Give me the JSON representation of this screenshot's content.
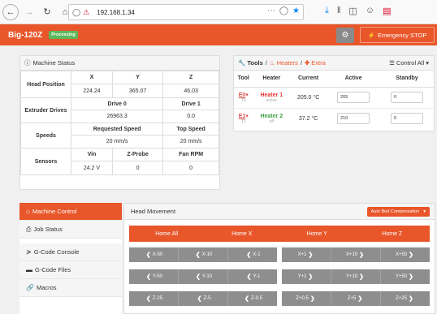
{
  "browser": {
    "url": "192.168.1.34",
    "icons": [
      "back-icon",
      "forward-icon",
      "reload-icon",
      "home-icon",
      "shield-icon",
      "insecure-lock-icon",
      "more-icon",
      "pocket-icon",
      "bookmark-star-icon",
      "download-icon",
      "library-icon",
      "sidebar-icon",
      "account-icon",
      "pocket-save-icon"
    ]
  },
  "topnav": {
    "brand": "Big-120Z",
    "status_badge": "Processing",
    "estop_label": "Emergency STOP",
    "colors": {
      "accent": "#e8562a",
      "badge": "#5cb85c"
    }
  },
  "machine_status": {
    "title": "Machine Status",
    "head_position": {
      "label": "Head Position",
      "axes": [
        "X",
        "Y",
        "Z"
      ],
      "values": [
        "224.24",
        "365.07",
        "46.03"
      ]
    },
    "extruder": {
      "label": "Extruder Drives",
      "headers": [
        "Drive 0",
        "Drive 1"
      ],
      "values": [
        "26963.3",
        "0.0"
      ]
    },
    "speeds": {
      "label": "Speeds",
      "headers": [
        "Requested Speed",
        "Top Speed"
      ],
      "values": [
        "20 mm/s",
        "20 mm/s"
      ]
    },
    "sensors": {
      "label": "Sensors",
      "headers": [
        "Vin",
        "Z-Probe",
        "Fan RPM"
      ],
      "values": [
        "24.2 V",
        "0",
        "0"
      ]
    }
  },
  "tools": {
    "title_tools": "Tools",
    "title_sep": "/",
    "title_heaters": "Heaters",
    "title_extra": "Extra",
    "control_all": "Control All",
    "headers": [
      "Tool",
      "Heater",
      "Current",
      "Active",
      "Standby"
    ],
    "rows": [
      {
        "tool": "E0",
        "sub": "T0",
        "heater": "Heater 1",
        "state": "active",
        "current": "205.0 °C",
        "active": "205",
        "standby": "0"
      },
      {
        "tool": "E1",
        "sub": "T1",
        "heater": "Heater 2",
        "state": "off",
        "current": "37.2 °C",
        "active": "210",
        "standby": "0"
      }
    ]
  },
  "sidebar": {
    "items": [
      {
        "label": "Machine Control",
        "icon": "home-icon"
      },
      {
        "label": "Job Status",
        "icon": "printer-icon"
      },
      {
        "label": "G-Code Console",
        "icon": "terminal-icon"
      },
      {
        "label": "G-Code Files",
        "icon": "hdd-icon"
      },
      {
        "label": "Macros",
        "icon": "link-icon"
      }
    ]
  },
  "head_movement": {
    "title": "Head Movement",
    "auto_bed": "Auto Bed Compensation",
    "home": [
      "Home All",
      "Home X",
      "Home Y",
      "Home Z"
    ],
    "x_neg": [
      "X-50",
      "X-10",
      "X-1"
    ],
    "x_pos": [
      "X+1",
      "X+10",
      "X+50"
    ],
    "y_neg": [
      "Y-50",
      "Y-10",
      "Y-1"
    ],
    "y_pos": [
      "Y+1",
      "Y+10",
      "Y+50"
    ],
    "z_neg": [
      "Z-25",
      "Z-5",
      "Z-0.5"
    ],
    "z_pos": [
      "Z+0.5",
      "Z+5",
      "Z+25"
    ]
  }
}
